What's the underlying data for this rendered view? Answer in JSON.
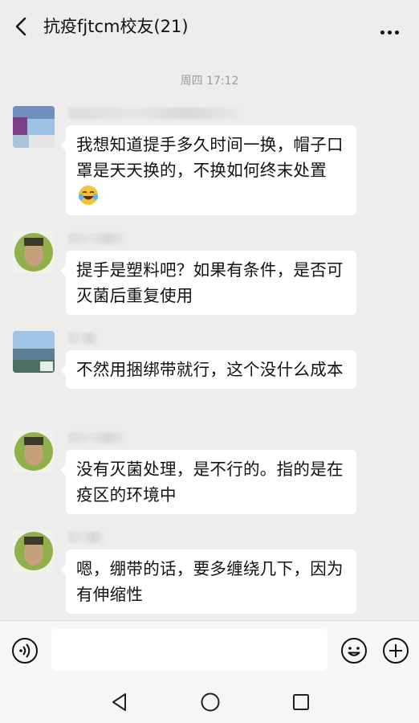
{
  "header": {
    "title": "抗疫fjtcm校友(21)",
    "back_icon": "chevron-left-icon",
    "more_icon": "more-dots-icon"
  },
  "timestamp": "周四 17:12",
  "messages": [
    {
      "text": "我想知道提手多久时间一换，帽子口罩是天天换的，不换如何终末处置",
      "emoji": "crying-laughing-emoji"
    },
    {
      "text": "提手是塑料吧？如果有条件，是否可灭菌后重复使用"
    },
    {
      "text": "不然用捆绑带就行，这个没什么成本"
    },
    {
      "text": "没有灭菌处理，是不行的。指的是在疫区的环境中"
    },
    {
      "text": "嗯，绷带的话，要多缠绕几下，因为有伸缩性"
    }
  ],
  "input_bar": {
    "message_value": "",
    "voice_icon": "voice-icon",
    "emoji_icon": "emoji-smile-icon",
    "plus_icon": "plus-circle-icon"
  },
  "nav_bar": {
    "back_icon": "triangle-back-icon",
    "home_icon": "circle-home-icon",
    "recent_icon": "square-recent-icon"
  },
  "colors": {
    "background": "#ededed",
    "bubble": "#ffffff",
    "text": "#111111",
    "timestamp": "#9a9a9a"
  }
}
